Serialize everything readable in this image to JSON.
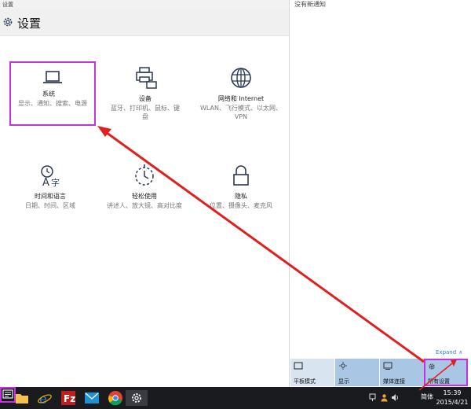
{
  "window": {
    "title": "设置"
  },
  "header": {
    "title": "设置"
  },
  "tiles": [
    {
      "name": "系统",
      "desc": "显示、通知、搜索、电源"
    },
    {
      "name": "设备",
      "desc": "蓝牙、打印机、鼠标、键盘"
    },
    {
      "name": "网络和 Internet",
      "desc": "WLAN、飞行模式、以太网、VPN"
    },
    {
      "name": "时间和语言",
      "desc": "日期、时间、区域"
    },
    {
      "name": "轻松使用",
      "desc": "讲述人、放大镜、高对比度"
    },
    {
      "name": "隐私",
      "desc": "位置、摄像头、麦克风"
    }
  ],
  "action_center": {
    "no_notifications": "没有新通知",
    "expand_label": "Expand",
    "quick_actions": [
      {
        "label": "平板模式"
      },
      {
        "label": "显示"
      },
      {
        "label": "媒体连接"
      },
      {
        "label": "所有设置"
      }
    ]
  },
  "taskbar": {
    "ime": "简体",
    "time": "15:39",
    "date": "2015/4/21"
  },
  "colors": {
    "highlight": "#c233d9",
    "arrow": "#e02020",
    "quick_action": "#a9c6e4",
    "accent_link": "#3a7bd5"
  }
}
